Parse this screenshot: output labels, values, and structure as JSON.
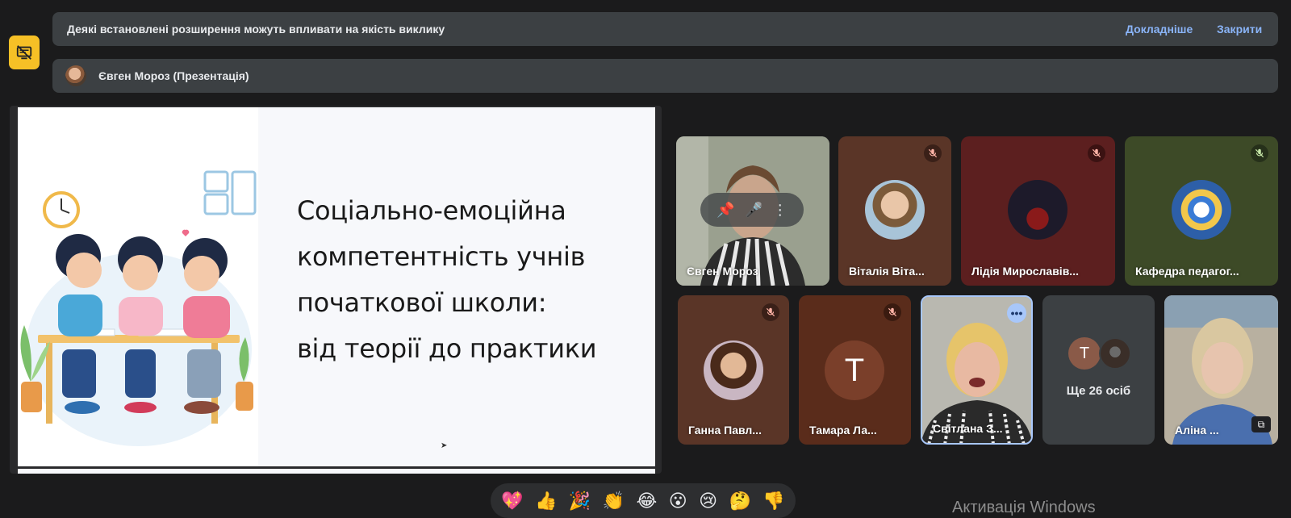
{
  "banners": {
    "warning_text": "Деякі встановлені розширення можуть впливати на якість виклику",
    "learn_more": "Докладніше",
    "close": "Закрити",
    "presentation_label": "Євген Мороз (Презентація)"
  },
  "slide": {
    "title_lines": [
      "Соціально-емоційна",
      "компетентність учнів",
      "початкової школи:",
      "від теорії до практики"
    ]
  },
  "participants": [
    {
      "name": "Євген Мороз"
    },
    {
      "name": "Віталія Віта..."
    },
    {
      "name": "Лідія Мирославів..."
    },
    {
      "name": "Кафедра педагог..."
    },
    {
      "name": "Ганна Павл..."
    },
    {
      "name": "Тамара Ла...",
      "initial": "Т"
    },
    {
      "name": "Світлана З..."
    },
    {
      "name": "Аліна ..."
    }
  ],
  "others": {
    "label": "Ще 26 осіб",
    "initial": "Т"
  },
  "reactions": [
    "💖",
    "👍",
    "🎉",
    "👏",
    "😂",
    "😮",
    "😢",
    "🤔",
    "👎"
  ],
  "watermark": "Активація Windows",
  "colors": {
    "accent_link": "#8ab4f8",
    "badge_yellow": "#f6c026",
    "banner_bg": "#3c4043",
    "page_bg": "#1b1b1c"
  }
}
